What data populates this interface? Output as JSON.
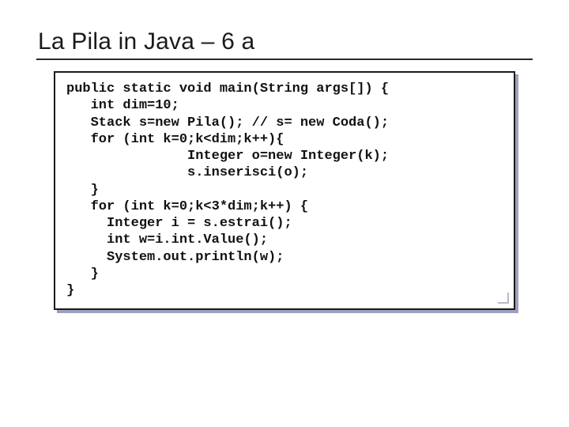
{
  "slide": {
    "title": "La Pila in Java – 6 a",
    "code": "public static void main(String args[]) {\n   int dim=10;\n   Stack s=new Pila(); // s= new Coda();\n   for (int k=0;k<dim;k++){\n               Integer o=new Integer(k);\n               s.inserisci(o);\n   }\n   for (int k=0;k<3*dim;k++) {\n     Integer i = s.estrai();\n     int w=i.int.Value();\n     System.out.println(w);\n   }\n}"
  }
}
